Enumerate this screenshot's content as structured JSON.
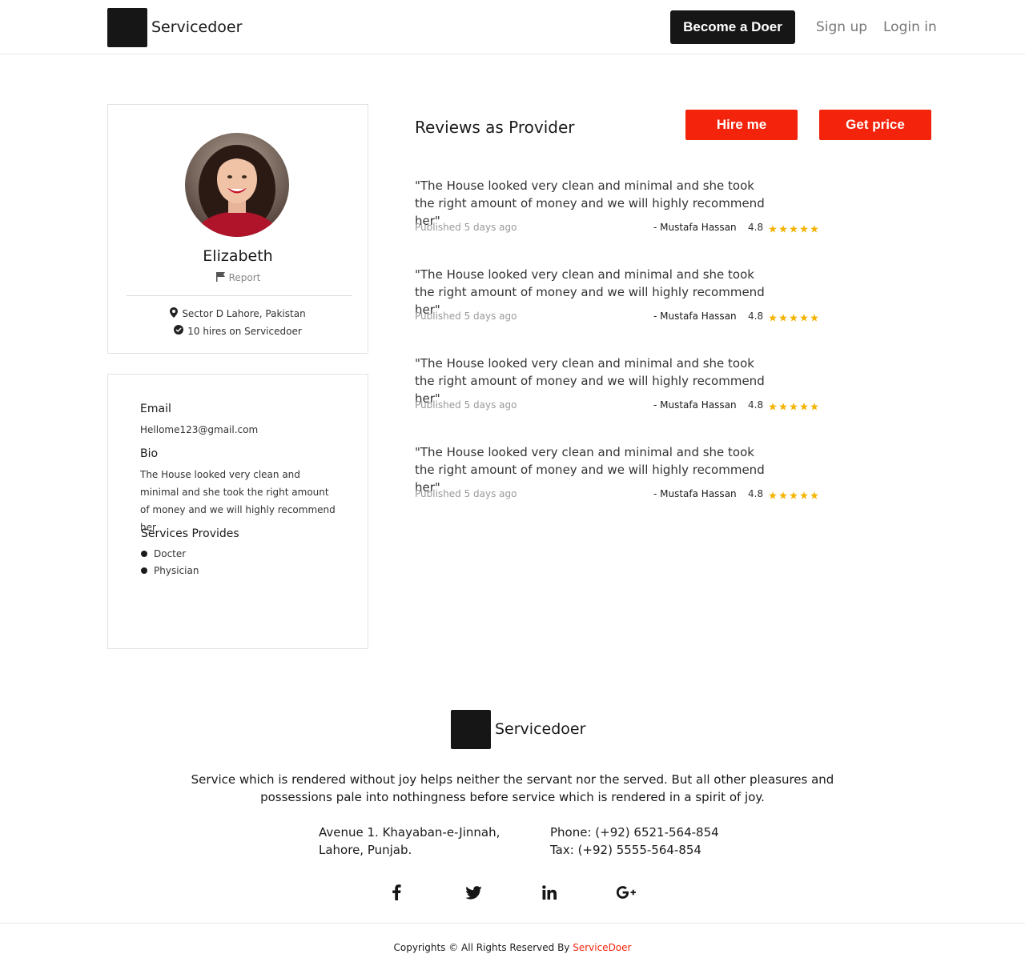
{
  "header": {
    "brand": "Servicedoer",
    "become_doer": "Become a Doer",
    "sign_up": "Sign up",
    "login": "Login in"
  },
  "profile": {
    "name": "Elizabeth",
    "report": "Report",
    "location": "Sector D Lahore, Pakistan",
    "hires": "10 hires on Servicedoer"
  },
  "info": {
    "email_label": "Email",
    "email": "Hellome123@gmail.com",
    "bio_label": "Bio",
    "bio": "The House looked very clean and minimal and she took the right amount of money and we will highly recommend her",
    "services_label": "Services Provides",
    "services": [
      "Docter",
      "Physician"
    ]
  },
  "reviews": {
    "title": "Reviews as Provider",
    "hire_me": "Hire me",
    "get_price": "Get price",
    "items": [
      {
        "text": "\"The House looked very clean and minimal and she took the right amount of money and we will highly recommend her\"",
        "date": "Published 5 days ago",
        "author": "- Mustafa Hassan",
        "rating": "4.8"
      },
      {
        "text": "\"The House looked very clean and minimal and she took the right amount of money and we will highly recommend her\"",
        "date": "Published 5 days ago",
        "author": "- Mustafa Hassan",
        "rating": "4.8"
      },
      {
        "text": "\"The House looked very clean and minimal and she took the right amount of money and we will highly recommend her\"",
        "date": "Published 5 days ago",
        "author": "- Mustafa Hassan",
        "rating": "4.8"
      },
      {
        "text": "\"The House looked very clean and minimal and she took the right amount of money and we will highly recommend her\"",
        "date": "Published 5 days ago",
        "author": "- Mustafa Hassan",
        "rating": "4.8"
      }
    ]
  },
  "footer": {
    "brand": "Servicedoer",
    "quote": "Service which is rendered without joy helps neither the servant nor the served. But all other pleasures and possessions pale into nothingness before service which is rendered in a spirit of joy.",
    "address_line1": "Avenue 1. Khayaban-e-Jinnah,",
    "address_line2": "Lahore, Punjab.",
    "phone": "Phone: (+92) 6521-564-854",
    "tax": "Tax: (+92) 5555-564-854",
    "copyright_prefix": "Copyrights © All Rights Reserved By ",
    "copyright_brand": "ServiceDoer"
  },
  "colors": {
    "accent_red": "#f4230b",
    "dark": "#161616",
    "star": "#f5b301"
  }
}
